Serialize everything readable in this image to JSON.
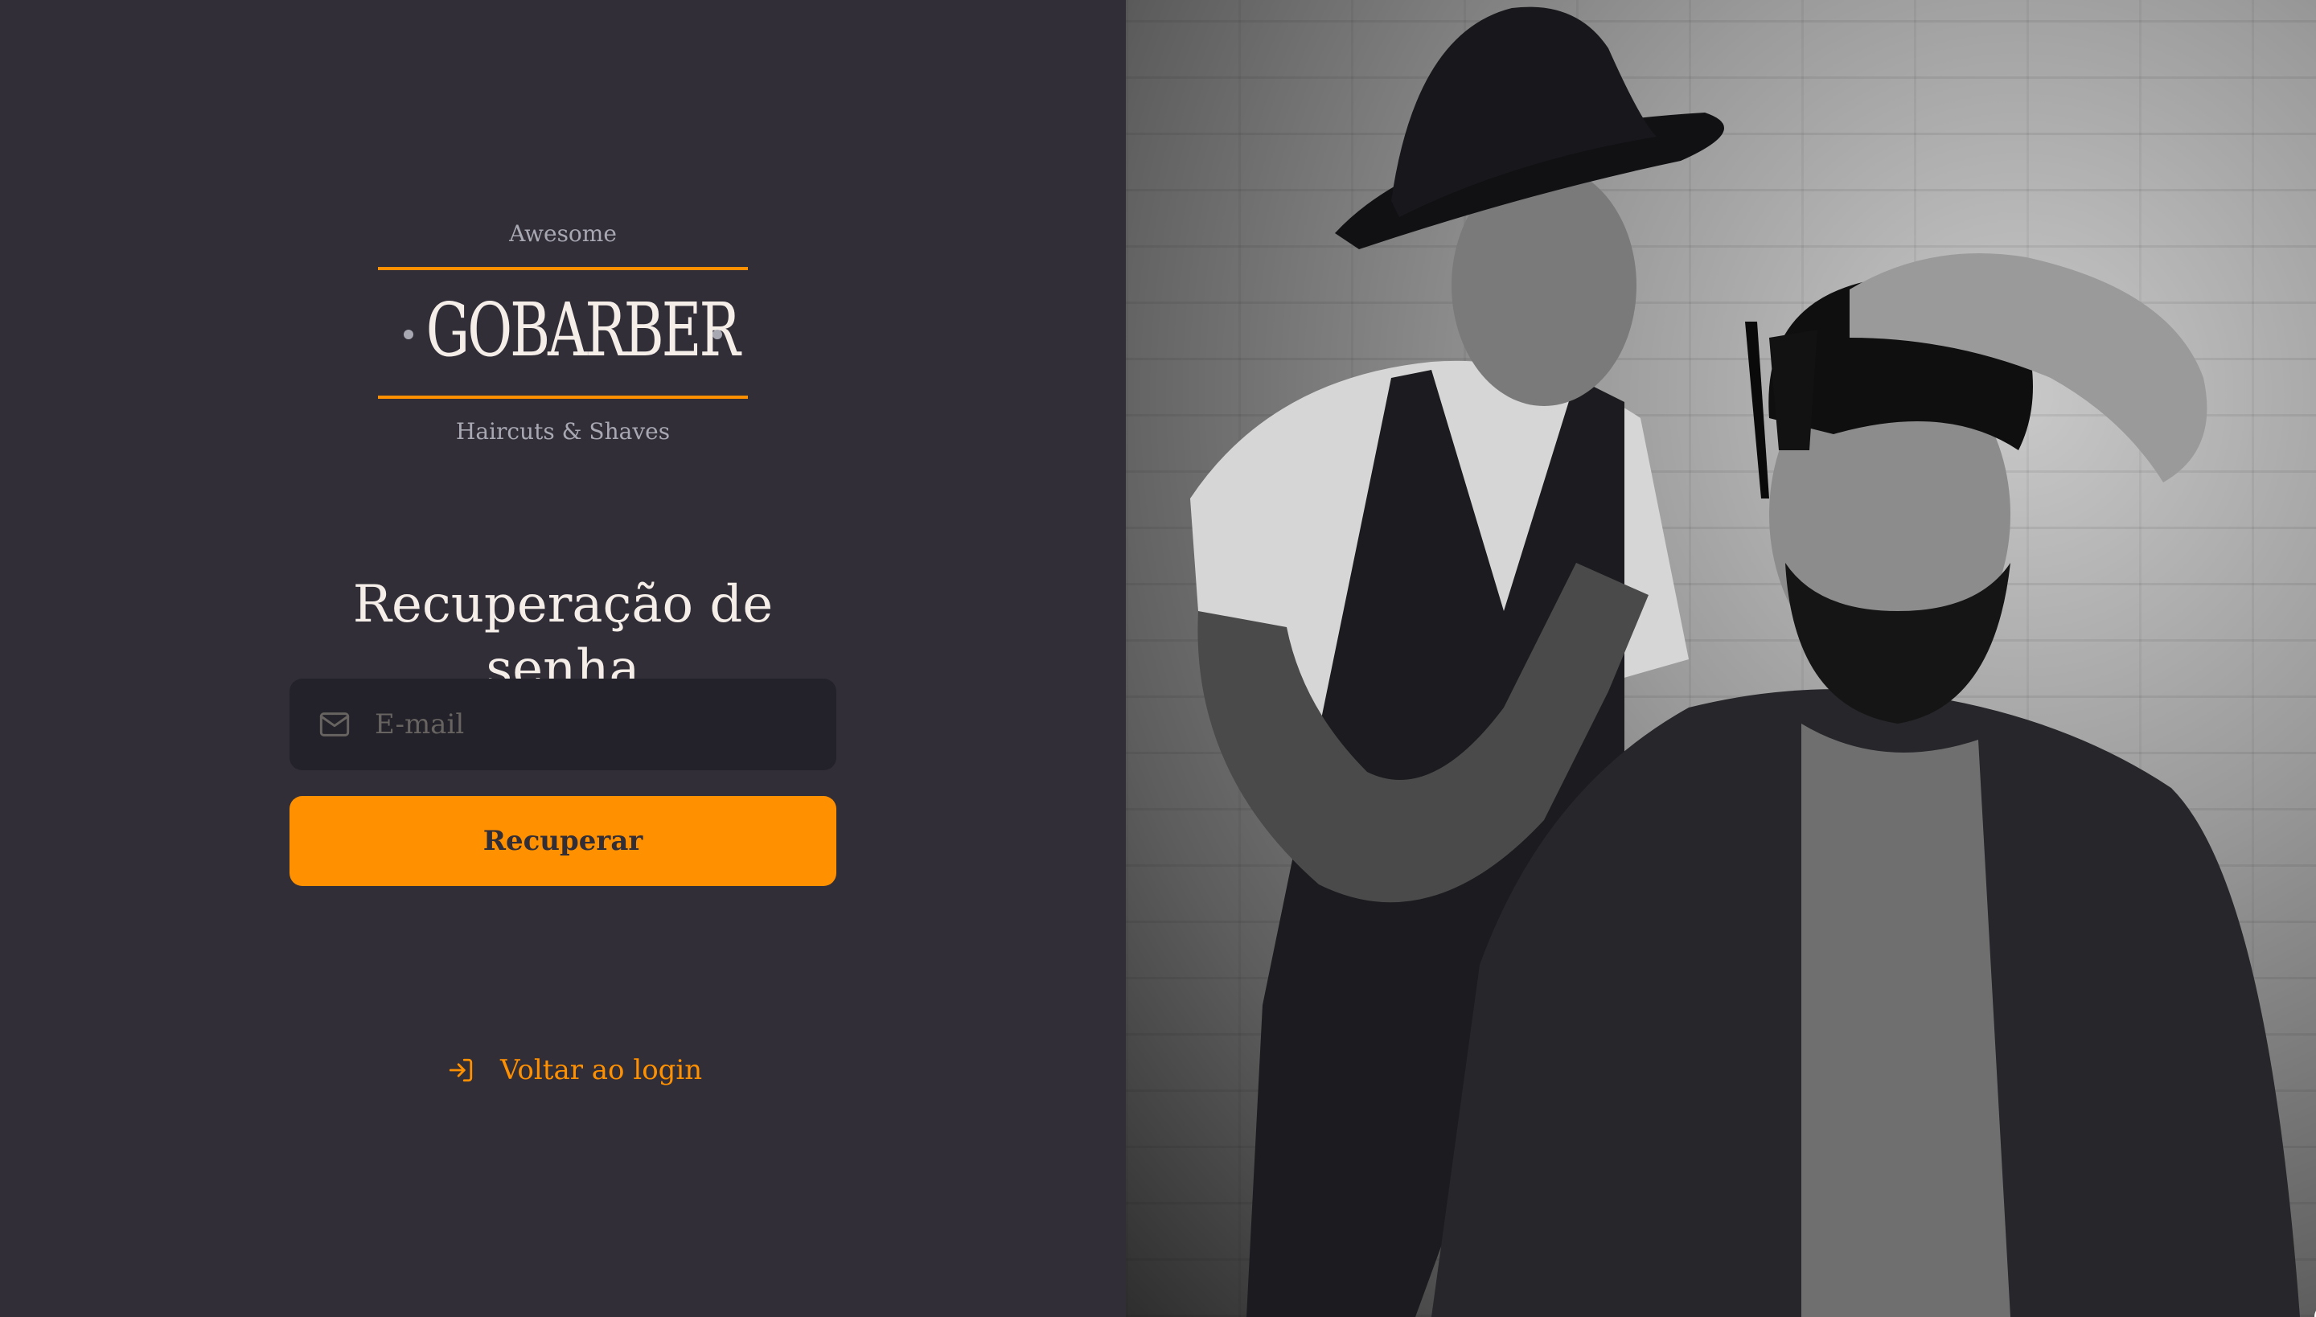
{
  "brand": {
    "tagline_top": "Awesome",
    "name": "GOBARBER",
    "tagline_bottom": "Haircuts & Shaves",
    "accent_color": "#ff9000"
  },
  "form": {
    "title": "Recuperação de senha",
    "email": {
      "placeholder": "E-mail",
      "value": "",
      "icon": "mail-icon"
    },
    "submit_label": "Recuperar"
  },
  "back_link": {
    "label": "Voltar ao login",
    "icon": "log-in-icon"
  },
  "background_image": {
    "subject": "barber-cutting-hair-photo"
  },
  "colors": {
    "background": "#312e38",
    "input_background": "#232129",
    "text": "#f4ede8",
    "muted": "#a8a8b3",
    "placeholder": "#666360"
  }
}
